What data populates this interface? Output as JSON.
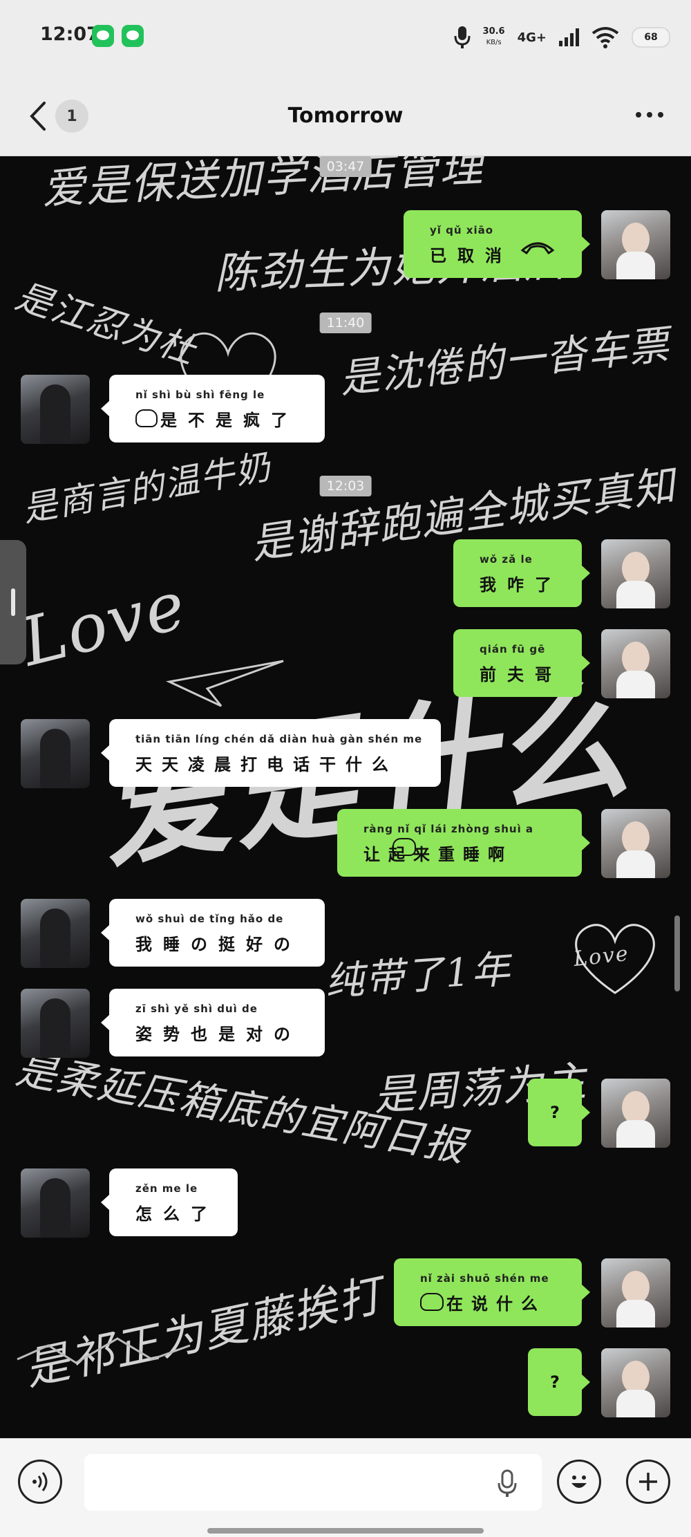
{
  "status": {
    "time": "12:07",
    "speed": "30.6",
    "speed_unit": "KB/s",
    "network": "4G+",
    "battery": "68"
  },
  "header": {
    "unread": "1",
    "title": "Tomorrow"
  },
  "background_text": [
    "爱是保送加学酒店管理",
    "陈劲生为她开酒店",
    "是江忍为杜",
    "是沈倦的一沓车票",
    "是商言的温牛奶",
    "是谢辞跑遍全城买真知",
    "Love",
    "爱是什么",
    "是周荡为主",
    "是柔延压箱底的宜阿日报",
    "是祁正为夏藤挨打",
    "纯带了1年",
    "Love"
  ],
  "timestamps": [
    "03:47",
    "11:40",
    "12:03"
  ],
  "messages": [
    {
      "side": "right",
      "pinyin": "yǐ  qǔ  xiāo",
      "text": "已取消",
      "call_icon": "hang-up-icon"
    },
    {
      "side": "left",
      "pinyin": "nǐ   shì  bù  shì fēng  le",
      "text": "是不是疯了",
      "emoji": true
    },
    {
      "side": "right",
      "pinyin": "wǒ  zǎ  le",
      "text": "我咋了"
    },
    {
      "side": "right",
      "pinyin": "qián fū  gē",
      "text": "前夫哥"
    },
    {
      "side": "left",
      "pinyin": "tiān tiān líng chén dǎ diàn huà gàn shén me",
      "text": "天天凌晨打电话干什么"
    },
    {
      "side": "right",
      "pinyin": "ràng  nǐ  qǐ  lái zhòng shuì  a",
      "text": "让起来重睡啊",
      "emoji": true
    },
    {
      "side": "left",
      "pinyin": "wǒ shuì  de  tǐng hǎo  de",
      "text": "我睡の挺好の"
    },
    {
      "side": "left",
      "pinyin": "zī  shì  yě  shì duì  de",
      "text": "姿势也是对の"
    },
    {
      "side": "right",
      "pinyin": "",
      "text": "?"
    },
    {
      "side": "left",
      "pinyin": "zěn  me  le",
      "text": "怎么了"
    },
    {
      "side": "right",
      "pinyin": "nǐ  zài shuō shén me",
      "text": "在说什么",
      "emoji": true
    },
    {
      "side": "right",
      "pinyin": "",
      "text": "?"
    }
  ],
  "input": {
    "placeholder": ""
  },
  "colors": {
    "bubble_green": "#8fe65a",
    "bubble_white": "#ffffff",
    "bar_bg": "#ededed"
  }
}
